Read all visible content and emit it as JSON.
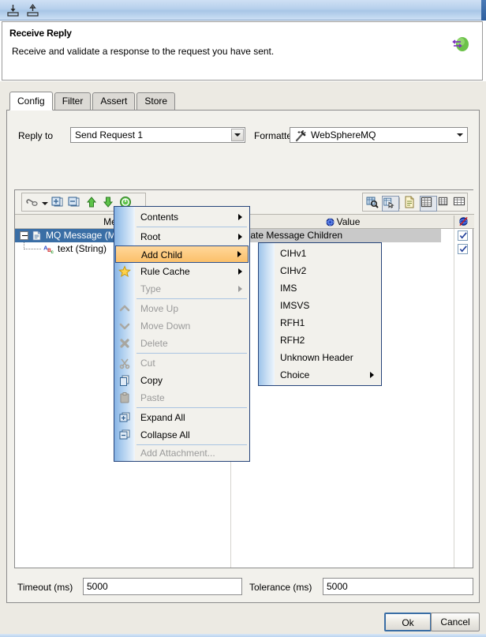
{
  "window": {
    "toolbar_icons": [
      {
        "name": "import-icon",
        "title": "Import"
      },
      {
        "name": "export-icon",
        "title": "Export"
      }
    ]
  },
  "header": {
    "title": "Receive Reply",
    "description": "Receive and validate a response to the request you have sent.",
    "icon": "receive-reply-icon"
  },
  "tabs": [
    {
      "label": "Config",
      "active": true
    },
    {
      "label": "Filter",
      "active": false
    },
    {
      "label": "Assert",
      "active": false
    },
    {
      "label": "Store",
      "active": false
    }
  ],
  "config": {
    "reply_to_label": "Reply to",
    "reply_to_value": "Send Request 1",
    "formatter_label": "Formatter",
    "formatter_value": "WebSphereMQ",
    "formatter_icon": "magic-wand-icon"
  },
  "tree_toolbar": {
    "left_buttons": [
      {
        "name": "attach-icon",
        "label": "Attach"
      },
      {
        "name": "dropdown-arrow-icon",
        "label": "More"
      },
      {
        "name": "expand-all-icon",
        "label": "Expand All"
      },
      {
        "name": "collapse-all-icon",
        "label": "Collapse All"
      },
      {
        "name": "move-up-icon",
        "label": "Move Up"
      },
      {
        "name": "move-down-icon",
        "label": "Move Down"
      },
      {
        "name": "type-icon",
        "label": "Type"
      }
    ],
    "right_buttons": [
      {
        "name": "find-icon",
        "label": "Find"
      },
      {
        "name": "find-select-icon",
        "label": "Find and Select",
        "selected": false
      },
      {
        "name": "document-view-icon",
        "label": "Document View"
      },
      {
        "name": "grid-view-icon",
        "label": "Grid View",
        "selected": true
      },
      {
        "name": "table-small-icon",
        "label": "Small Table"
      },
      {
        "name": "table-large-icon",
        "label": "Large Table"
      }
    ]
  },
  "tree": {
    "columns": [
      {
        "label": "Message",
        "name": "column-message"
      },
      {
        "label": "Value",
        "name": "column-value",
        "icon": "sphere-icon"
      },
      {
        "label": "",
        "name": "column-validate",
        "icon": "no-validate-icon"
      }
    ],
    "rows": [
      {
        "name": "MQ Message (M...",
        "value": "...idate Message Children",
        "checked": true,
        "selected": true,
        "indent": 0,
        "icon": "message-document-icon",
        "expander": "minus"
      },
      {
        "name": "text (String)",
        "value": "",
        "checked": true,
        "selected": false,
        "indent": 1,
        "icon": "string-abc-icon",
        "expander": "none"
      }
    ]
  },
  "fields": {
    "timeout_label": "Timeout (ms)",
    "timeout_value": "5000",
    "tolerance_label": "Tolerance (ms)",
    "tolerance_value": "5000"
  },
  "dialog_buttons": {
    "ok": "Ok",
    "cancel": "Cancel"
  },
  "context_menu": {
    "items": [
      {
        "label": "Contents",
        "icon": "",
        "submenu": true,
        "disabled": false,
        "highlighted": false,
        "sep_after": true
      },
      {
        "label": "Root",
        "icon": "",
        "submenu": true,
        "disabled": false,
        "highlighted": false,
        "sep_after": false
      },
      {
        "label": "Add Child",
        "icon": "",
        "submenu": true,
        "disabled": false,
        "highlighted": true,
        "sep_after": false
      },
      {
        "label": "Rule Cache",
        "icon": "star-icon",
        "submenu": true,
        "disabled": false,
        "highlighted": false,
        "sep_after": false
      },
      {
        "label": "Type",
        "icon": "",
        "submenu": true,
        "disabled": true,
        "highlighted": false,
        "sep_after": true
      },
      {
        "label": "Move Up",
        "icon": "chevron-up-icon",
        "submenu": false,
        "disabled": true,
        "highlighted": false,
        "sep_after": false
      },
      {
        "label": "Move Down",
        "icon": "chevron-down-icon",
        "submenu": false,
        "disabled": true,
        "highlighted": false,
        "sep_after": false
      },
      {
        "label": "Delete",
        "icon": "delete-x-icon",
        "submenu": false,
        "disabled": true,
        "highlighted": false,
        "sep_after": true
      },
      {
        "label": "Cut",
        "icon": "cut-scissors-icon",
        "submenu": false,
        "disabled": true,
        "highlighted": false,
        "sep_after": false
      },
      {
        "label": "Copy",
        "icon": "copy-icon",
        "submenu": false,
        "disabled": false,
        "highlighted": false,
        "sep_after": false
      },
      {
        "label": "Paste",
        "icon": "paste-icon",
        "submenu": false,
        "disabled": true,
        "highlighted": false,
        "sep_after": true
      },
      {
        "label": "Expand All",
        "icon": "expand-all-icon",
        "submenu": false,
        "disabled": false,
        "highlighted": false,
        "sep_after": false
      },
      {
        "label": "Collapse All",
        "icon": "collapse-all-icon",
        "submenu": false,
        "disabled": false,
        "highlighted": false,
        "sep_after": true
      },
      {
        "label": "Add Attachment...",
        "icon": "",
        "submenu": false,
        "disabled": true,
        "highlighted": false,
        "sep_after": false
      }
    ]
  },
  "add_child_submenu": {
    "items": [
      {
        "label": "CIHv1",
        "submenu": false
      },
      {
        "label": "CIHv2",
        "submenu": false
      },
      {
        "label": "IMS",
        "submenu": false
      },
      {
        "label": "IMSVS",
        "submenu": false
      },
      {
        "label": "RFH1",
        "submenu": false
      },
      {
        "label": "RFH2",
        "submenu": false
      },
      {
        "label": "Unknown Header",
        "submenu": false
      },
      {
        "label": "Choice",
        "submenu": true
      }
    ]
  },
  "colors": {
    "selection_blue": "#3a6ea5",
    "menu_highlight": "#fbc06a",
    "menu_border": "#26447a",
    "titlebar_blue": "#b6d0ec"
  }
}
